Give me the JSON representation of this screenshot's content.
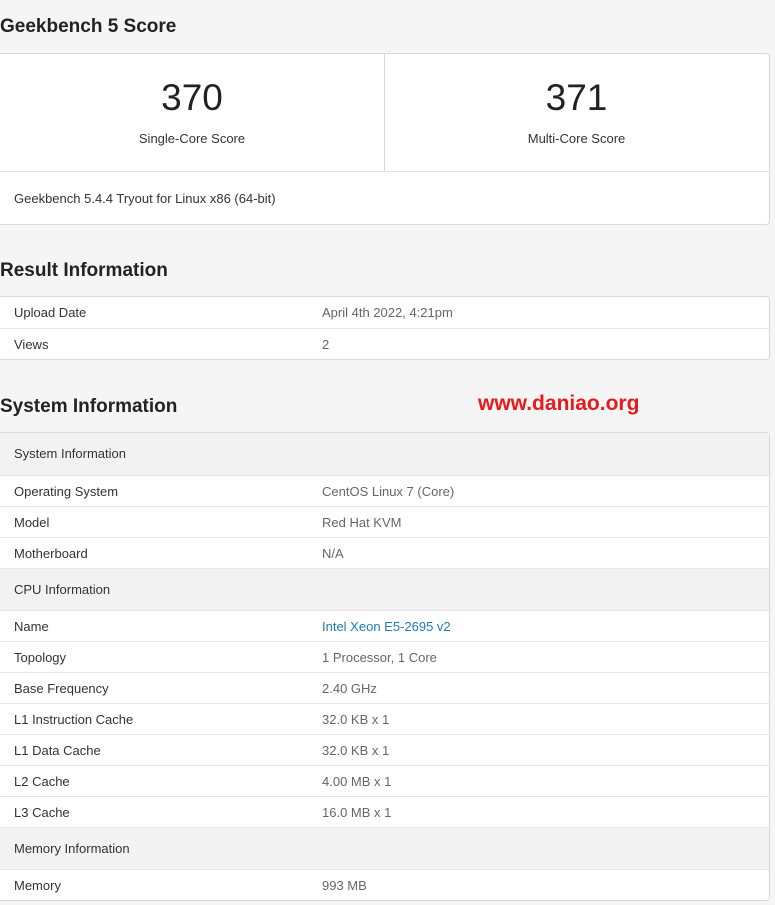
{
  "score_section": {
    "title": "Geekbench 5 Score",
    "single_core_score": "370",
    "single_core_label": "Single-Core Score",
    "multi_core_score": "371",
    "multi_core_label": "Multi-Core Score",
    "version_text": "Geekbench 5.4.4 Tryout for Linux x86 (64-bit)"
  },
  "result_info": {
    "title": "Result Information",
    "rows": [
      {
        "key": "Upload Date",
        "value": "April 4th 2022, 4:21pm"
      },
      {
        "key": "Views",
        "value": "2"
      }
    ]
  },
  "system_info": {
    "title": "System Information",
    "sections": [
      {
        "header": "System Information",
        "rows": [
          {
            "key": "Operating System",
            "value": "CentOS Linux 7 (Core)"
          },
          {
            "key": "Model",
            "value": "Red Hat KVM"
          },
          {
            "key": "Motherboard",
            "value": "N/A"
          }
        ]
      },
      {
        "header": "CPU Information",
        "rows": [
          {
            "key": "Name",
            "value": "Intel Xeon E5-2695 v2"
          },
          {
            "key": "Topology",
            "value": "1 Processor, 1 Core"
          },
          {
            "key": "Base Frequency",
            "value": "2.40 GHz"
          },
          {
            "key": "L1 Instruction Cache",
            "value": "32.0 KB x 1"
          },
          {
            "key": "L1 Data Cache",
            "value": "32.0 KB x 1"
          },
          {
            "key": "L2 Cache",
            "value": "4.00 MB x 1"
          },
          {
            "key": "L3 Cache",
            "value": "16.0 MB x 1"
          }
        ]
      },
      {
        "header": "Memory Information",
        "rows": [
          {
            "key": "Memory",
            "value": "993 MB"
          }
        ]
      }
    ]
  },
  "watermark": "www.daniao.org",
  "colors": {
    "link": "#1f7ab8",
    "watermark": "#e8191b"
  }
}
